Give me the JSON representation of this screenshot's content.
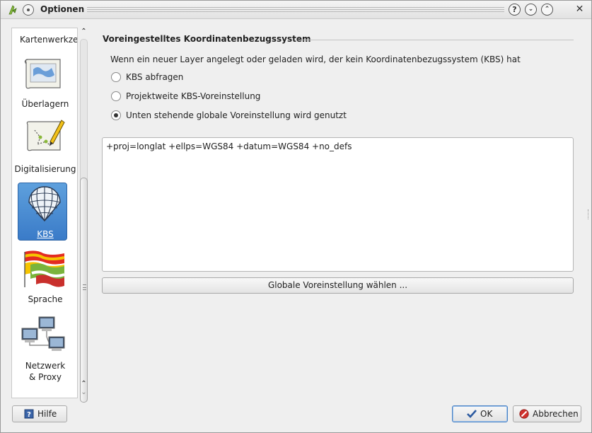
{
  "window": {
    "title": "Optionen",
    "buttons": [
      "help-button",
      "minimize-button",
      "maximize-button",
      "close-button"
    ],
    "help_glyph": "?",
    "min_glyph": "⌄",
    "max_glyph": "⌃",
    "close_glyph": "✕"
  },
  "sidebar": {
    "items": [
      {
        "label": "Kartenwerkze",
        "icon": "map-tools-icon"
      },
      {
        "label": "Überlagern",
        "icon": "overlay-map-icon"
      },
      {
        "label": "Digitalisierung",
        "icon": "digitize-pencil-icon"
      },
      {
        "label": "KBS",
        "icon": "globe-grid-icon",
        "active": true
      },
      {
        "label": "Sprache",
        "icon": "flags-icon"
      },
      {
        "label": "Netzwerk",
        "label2": "& Proxy",
        "icon": "network-computers-icon"
      }
    ]
  },
  "crs_group": {
    "title": "Voreingestelltes Koordinatenbezugssystem",
    "description": "Wenn ein neuer Layer angelegt oder geladen wird, der kein Koordinatenbezugssystem (KBS) hat",
    "options": [
      {
        "label": "KBS abfragen",
        "checked": false
      },
      {
        "label": "Projektweite KBS-Voreinstellung",
        "checked": false
      },
      {
        "label": "Unten stehende globale Voreinstellung wird genutzt",
        "checked": true
      }
    ],
    "proj_string": "+proj=longlat +ellps=WGS84 +datum=WGS84 +no_defs",
    "select_button": "Globale Voreinstellung wählen ..."
  },
  "footer": {
    "help_label": "Hilfe",
    "ok_label": "OK",
    "cancel_label": "Abbrechen"
  },
  "colors": {
    "active_item": "#4a8ed6",
    "window_bg": "#efefef",
    "cancel_icon": "#d0312d",
    "ok_icon": "#2c5aa0"
  }
}
